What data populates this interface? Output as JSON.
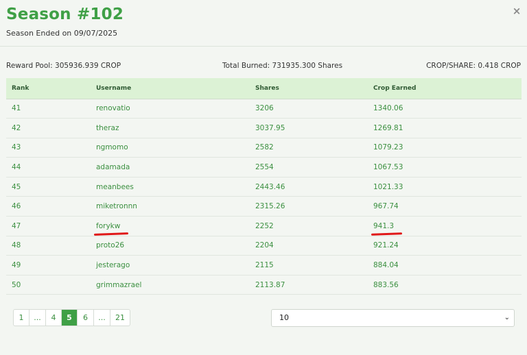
{
  "header": {
    "title": "Season #102",
    "subtitle": "Season Ended on 09/07/2025",
    "close_icon": "×"
  },
  "stats": {
    "reward_pool": "Reward Pool: 305936.939 CROP",
    "total_burned": "Total Burned: 731935.300 Shares",
    "crop_per_share": "CROP/SHARE: 0.418 CROP"
  },
  "table": {
    "columns": [
      "Rank",
      "Username",
      "Shares",
      "Crop Earned"
    ],
    "rows": [
      {
        "rank": "41",
        "username": "renovatio",
        "shares": "3206",
        "crop": "1340.06"
      },
      {
        "rank": "42",
        "username": "theraz",
        "shares": "3037.95",
        "crop": "1269.81"
      },
      {
        "rank": "43",
        "username": "ngmomo",
        "shares": "2582",
        "crop": "1079.23"
      },
      {
        "rank": "44",
        "username": "adamada",
        "shares": "2554",
        "crop": "1067.53"
      },
      {
        "rank": "45",
        "username": "meanbees",
        "shares": "2443.46",
        "crop": "1021.33"
      },
      {
        "rank": "46",
        "username": "miketronnn",
        "shares": "2315.26",
        "crop": "967.74"
      },
      {
        "rank": "47",
        "username": "forykw",
        "shares": "2252",
        "crop": "941.3"
      },
      {
        "rank": "48",
        "username": "proto26",
        "shares": "2204",
        "crop": "921.24"
      },
      {
        "rank": "49",
        "username": "jesterago",
        "shares": "2115",
        "crop": "884.04"
      },
      {
        "rank": "50",
        "username": "grimmazrael",
        "shares": "2113.87",
        "crop": "883.56"
      }
    ]
  },
  "pagination": {
    "pages": [
      "1",
      "...",
      "4",
      "5",
      "6",
      "...",
      "21"
    ],
    "active": "5"
  },
  "page_size": {
    "selected": "10",
    "chevron_icon": "⌄"
  },
  "colors": {
    "accent": "#3fa046",
    "header_row": "#dcf2d5",
    "highlight_mark": "#e01818"
  }
}
